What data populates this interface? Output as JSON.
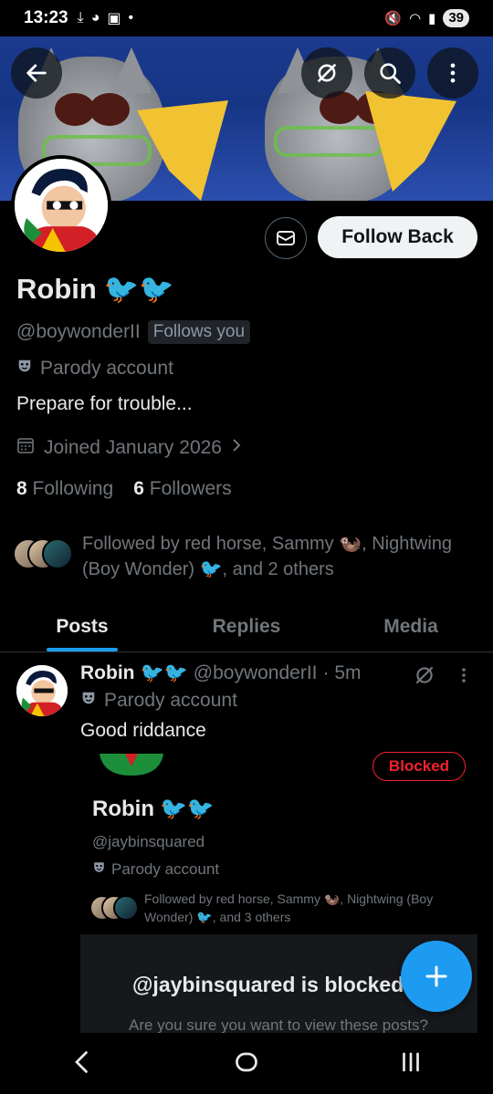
{
  "status_bar": {
    "time": "13:23",
    "battery": "39"
  },
  "profile": {
    "name": "Robin",
    "name_emoji": "🐦🐦",
    "handle": "@boywonderII",
    "follows_you": "Follows you",
    "parody_label": "Parody account",
    "bio": "Prepare for trouble...",
    "joined": "Joined January 2026",
    "following_count": "8",
    "following_label": "Following",
    "followers_count": "6",
    "followers_label": "Followers",
    "followed_by": "Followed by red horse, Sammy 🦦, Nightwing (Boy Wonder) 🐦, and 2 others",
    "follow_back_label": "Follow Back"
  },
  "tabs": [
    {
      "label": "Posts",
      "active": true
    },
    {
      "label": "Replies",
      "active": false
    },
    {
      "label": "Media",
      "active": false
    }
  ],
  "post": {
    "author": "Robin",
    "author_emoji": "🐦🐦",
    "handle": "@boywonderII",
    "time": "· 5m",
    "parody_label": "Parody account",
    "text": "Good riddance",
    "quoted": {
      "blocked_badge": "Blocked",
      "name": "Robin",
      "name_emoji": "🐦🐦",
      "handle": "@jaybinsquared",
      "parody_label": "Parody account",
      "followed_by": "Followed by red horse, Sammy 🦦, Nightwing (Boy Wonder) 🐦, and 3 others",
      "blocked_title": "@jaybinsquared is blocked",
      "blocked_sub": "Are you sure you want to view these posts?"
    }
  },
  "colors": {
    "accent": "#1d9bf0",
    "blocked": "#f4212e",
    "muted": "#71767b",
    "background": "#000000"
  },
  "icons": [
    "back-arrow-icon",
    "grok-icon",
    "search-icon",
    "more-vertical-icon",
    "envelope-icon",
    "calendar-icon",
    "chevron-right-icon",
    "parody-mask-icon",
    "plus-icon"
  ]
}
